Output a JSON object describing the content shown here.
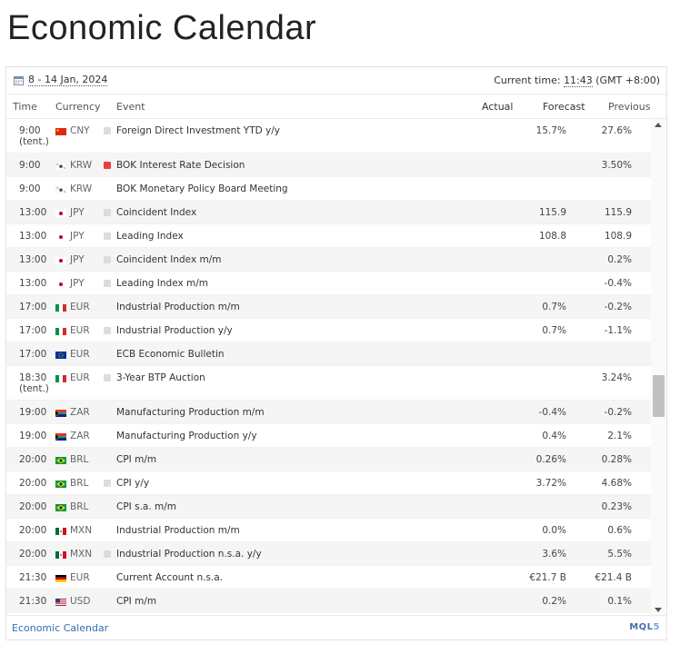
{
  "page": {
    "title": "Economic Calendar"
  },
  "topbar": {
    "date_range": "8 - 14 Jan, 2024",
    "current_time_label": "Current time: ",
    "current_time": "11:43",
    "timezone": " (GMT +8:00)"
  },
  "columns": {
    "time": "Time",
    "currency": "Currency",
    "event": "Event",
    "actual": "Actual",
    "forecast": "Forecast",
    "previous": "Previous"
  },
  "colors": {
    "importance_high": "#e8403f",
    "importance_medium": "#f5c02f",
    "importance_low": "#dcdcdc",
    "link": "#2f6fae"
  },
  "events": [
    {
      "time": "9:00",
      "time2": "(tent.)",
      "flag": "cn-flag",
      "currency": "CNY",
      "importance": "low",
      "event": "Foreign Direct Investment YTD y/y",
      "actual": "",
      "forecast": "15.7%",
      "previous": "27.6%"
    },
    {
      "time": "9:00",
      "time2": "",
      "flag": "kr-flag",
      "currency": "KRW",
      "importance": "high",
      "event": "BOK Interest Rate Decision",
      "actual": "",
      "forecast": "",
      "previous": "3.50%"
    },
    {
      "time": "9:00",
      "time2": "",
      "flag": "kr-flag",
      "currency": "KRW",
      "importance": "medium",
      "event": "BOK Monetary Policy Board Meeting",
      "actual": "",
      "forecast": "",
      "previous": ""
    },
    {
      "time": "13:00",
      "time2": "",
      "flag": "jp-flag",
      "currency": "JPY",
      "importance": "low",
      "event": "Coincident Index",
      "actual": "",
      "forecast": "115.9",
      "previous": "115.9"
    },
    {
      "time": "13:00",
      "time2": "",
      "flag": "jp-flag",
      "currency": "JPY",
      "importance": "low",
      "event": "Leading Index",
      "actual": "",
      "forecast": "108.8",
      "previous": "108.9"
    },
    {
      "time": "13:00",
      "time2": "",
      "flag": "jp-flag",
      "currency": "JPY",
      "importance": "low",
      "event": "Coincident Index m/m",
      "actual": "",
      "forecast": "",
      "previous": "0.2%"
    },
    {
      "time": "13:00",
      "time2": "",
      "flag": "jp-flag",
      "currency": "JPY",
      "importance": "low",
      "event": "Leading Index m/m",
      "actual": "",
      "forecast": "",
      "previous": "-0.4%"
    },
    {
      "time": "17:00",
      "time2": "",
      "flag": "it-flag",
      "currency": "EUR",
      "importance": "medium",
      "event": "Industrial Production m/m",
      "actual": "",
      "forecast": "0.7%",
      "previous": "-0.2%"
    },
    {
      "time": "17:00",
      "time2": "",
      "flag": "it-flag",
      "currency": "EUR",
      "importance": "low",
      "event": "Industrial Production y/y",
      "actual": "",
      "forecast": "0.7%",
      "previous": "-1.1%"
    },
    {
      "time": "17:00",
      "time2": "",
      "flag": "eu-flag",
      "currency": "EUR",
      "importance": "medium",
      "event": "ECB Economic Bulletin",
      "actual": "",
      "forecast": "",
      "previous": ""
    },
    {
      "time": "18:30",
      "time2": "(tent.)",
      "flag": "it-flag",
      "currency": "EUR",
      "importance": "low",
      "event": "3-Year BTP Auction",
      "actual": "",
      "forecast": "",
      "previous": "3.24%"
    },
    {
      "time": "19:00",
      "time2": "",
      "flag": "za-flag",
      "currency": "ZAR",
      "importance": "medium",
      "event": "Manufacturing Production m/m",
      "actual": "",
      "forecast": "-0.4%",
      "previous": "-0.2%"
    },
    {
      "time": "19:00",
      "time2": "",
      "flag": "za-flag",
      "currency": "ZAR",
      "importance": "medium",
      "event": "Manufacturing Production y/y",
      "actual": "",
      "forecast": "0.4%",
      "previous": "2.1%"
    },
    {
      "time": "20:00",
      "time2": "",
      "flag": "br-flag",
      "currency": "BRL",
      "importance": "medium",
      "event": "CPI m/m",
      "actual": "",
      "forecast": "0.26%",
      "previous": "0.28%"
    },
    {
      "time": "20:00",
      "time2": "",
      "flag": "br-flag",
      "currency": "BRL",
      "importance": "low",
      "event": "CPI y/y",
      "actual": "",
      "forecast": "3.72%",
      "previous": "4.68%"
    },
    {
      "time": "20:00",
      "time2": "",
      "flag": "br-flag",
      "currency": "BRL",
      "importance": "medium",
      "event": "CPI s.a. m/m",
      "actual": "",
      "forecast": "",
      "previous": "0.23%"
    },
    {
      "time": "20:00",
      "time2": "",
      "flag": "mx-flag",
      "currency": "MXN",
      "importance": "medium",
      "event": "Industrial Production m/m",
      "actual": "",
      "forecast": "0.0%",
      "previous": "0.6%"
    },
    {
      "time": "20:00",
      "time2": "",
      "flag": "mx-flag",
      "currency": "MXN",
      "importance": "low",
      "event": "Industrial Production n.s.a. y/y",
      "actual": "",
      "forecast": "3.6%",
      "previous": "5.5%"
    },
    {
      "time": "21:30",
      "time2": "",
      "flag": "de-flag",
      "currency": "EUR",
      "importance": "medium",
      "event": "Current Account n.s.a.",
      "actual": "",
      "forecast": "€21.7 B",
      "previous": "€21.4 B"
    },
    {
      "time": "21:30",
      "time2": "",
      "flag": "us-flag",
      "currency": "USD",
      "importance": "medium",
      "event": "CPI m/m",
      "actual": "",
      "forecast": "0.2%",
      "previous": "0.1%"
    }
  ],
  "footer": {
    "link": "Economic Calendar",
    "logo_main": "MQL",
    "logo_suffix": "5"
  }
}
